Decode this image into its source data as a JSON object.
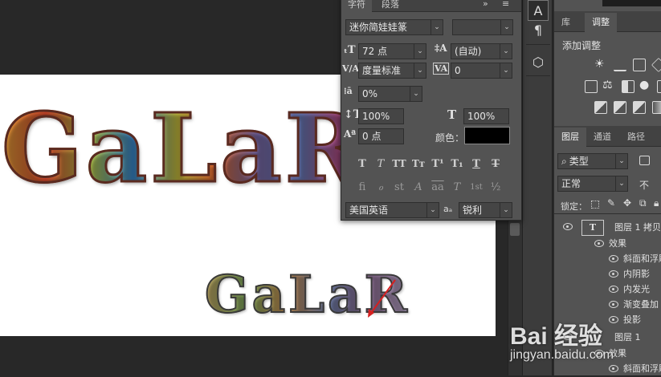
{
  "canvas": {
    "art_large_text": "GaLaR",
    "art_small_text": "GaLaR"
  },
  "tool_strip": {
    "items": [
      "A",
      "¶",
      "⬡"
    ]
  },
  "character_panel": {
    "tabs": [
      "字符",
      "段落"
    ],
    "menu_icons": [
      "»",
      "≡"
    ],
    "font_family": "迷你简娃娃篆",
    "font_style": "",
    "font_size": "72 点",
    "leading": "(自动)",
    "kerning": "度量标准",
    "tracking": "0",
    "tsume": "0%",
    "vertical_scale": "100%",
    "horizontal_scale": "100%",
    "baseline_shift": "0 点",
    "color_label": "颜色：",
    "color_value": "#000000",
    "style_buttons_row1": [
      "T",
      "T",
      "TT",
      "Tт",
      "T¹",
      "T₁",
      "T",
      "T"
    ],
    "style_buttons_row2": [
      "fi",
      "ℴ",
      "st",
      "A",
      "aa",
      "T",
      "1st",
      "½"
    ],
    "language": "美国英语",
    "aa_label": "aₐ",
    "antialias": "锐利"
  },
  "right_panels": {
    "top_tabs": [
      "库",
      "调整"
    ],
    "adjustments_title": "添加调整",
    "layer_tabs": [
      "图层",
      "通道",
      "路径"
    ],
    "filter_kind": "类型",
    "blend_mode": "正常",
    "lock_label": "锁定：",
    "layers": [
      {
        "name": "图层 1 拷贝",
        "type": "text",
        "indent": 0
      },
      {
        "name": "效果",
        "type": "effects",
        "indent": 1
      },
      {
        "name": "斜面和浮雕",
        "type": "effect",
        "indent": 2
      },
      {
        "name": "内阴影",
        "type": "effect",
        "indent": 2
      },
      {
        "name": "内发光",
        "type": "effect",
        "indent": 2
      },
      {
        "name": "渐变叠加",
        "type": "effect",
        "indent": 2
      },
      {
        "name": "投影",
        "type": "effect",
        "indent": 2
      },
      {
        "name": "图层 1",
        "type": "text",
        "indent": 0
      },
      {
        "name": "效果",
        "type": "effects",
        "indent": 1
      },
      {
        "name": "斜面和浮雕",
        "type": "effect",
        "indent": 2
      }
    ]
  },
  "watermark": {
    "brand": "Bai 经验",
    "url": "jingyan.baidu.com"
  },
  "colors": {
    "panel_bg": "#535353",
    "dark_bg": "#282828",
    "annotation_red": "#d62020"
  }
}
